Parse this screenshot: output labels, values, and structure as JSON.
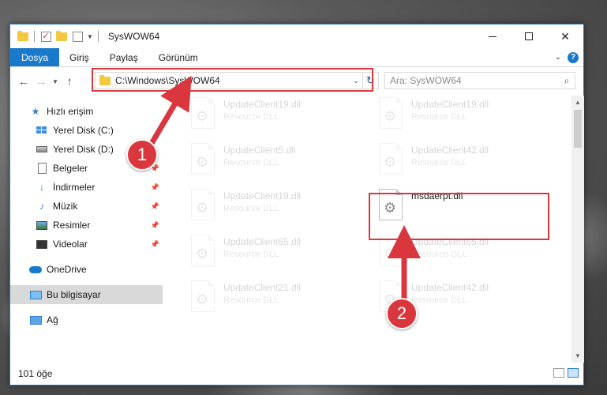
{
  "window": {
    "title": "SysWOW64"
  },
  "ribbon": {
    "tabs": [
      "Dosya",
      "Giriş",
      "Paylaş",
      "Görünüm"
    ]
  },
  "address": {
    "path": "C:\\Windows\\SysWOW64"
  },
  "search": {
    "placeholder": "Ara: SysWOW64"
  },
  "navpane": {
    "quick_access": "Hızlı erişim",
    "items": [
      "Yerel Disk (C:)",
      "Yerel Disk (D:)",
      "Belgeler",
      "İndirmeler",
      "Müzik",
      "Resimler",
      "Videolar"
    ],
    "onedrive": "OneDrive",
    "this_pc": "Bu bilgisayar",
    "network": "Ağ"
  },
  "files": [
    {
      "name": "UpdateClient19.dll",
      "desc": "Resource DLL"
    },
    {
      "name": "UpdateClient19.dll",
      "desc": "Resource DLL"
    },
    {
      "name": "UpdateClient5.dll",
      "desc": "Resource DLL"
    },
    {
      "name": "UpdateClient42.dll",
      "desc": "Resource DLL"
    },
    {
      "name": "UpdateClient19.dll",
      "desc": "Resource DLL"
    },
    {
      "name": "msdaerpt.dll",
      "desc": ""
    },
    {
      "name": "UpdateClient65.dll",
      "desc": "Resource DLL"
    },
    {
      "name": "UpdateClient65.dll",
      "desc": "Resource DLL"
    },
    {
      "name": "UpdateClient21.dll",
      "desc": "Resource DLL"
    },
    {
      "name": "UpdateClient42.dll",
      "desc": "Resource DLL"
    }
  ],
  "status": {
    "count": "101 öğe"
  },
  "annotations": {
    "step1": "1",
    "step2": "2"
  },
  "colors": {
    "accent": "#1979ca",
    "highlight": "#d9363e"
  }
}
